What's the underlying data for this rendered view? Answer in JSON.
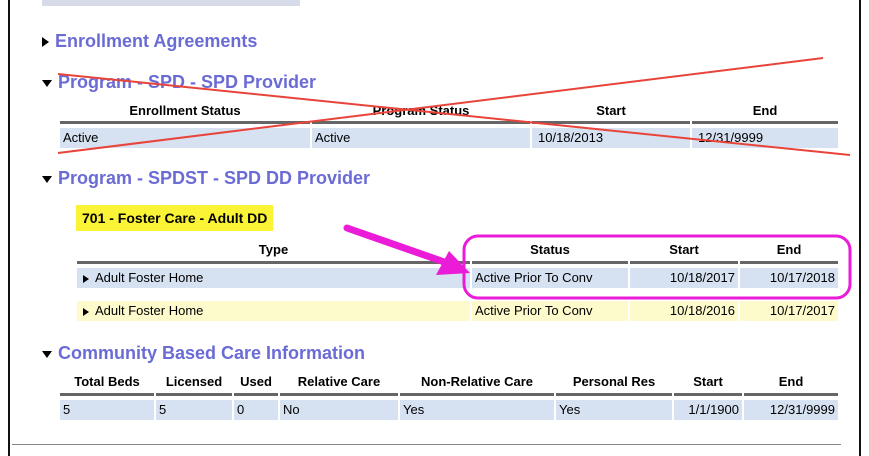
{
  "sections": {
    "enrollment": {
      "title": "Enrollment Agreements"
    },
    "program_spd": {
      "title": "Program - SPD - SPD Provider",
      "headers": [
        "Enrollment Status",
        "Program Status",
        "Start",
        "End"
      ],
      "row": [
        "Active",
        "Active",
        "10/18/2013",
        "12/31/9999"
      ]
    },
    "program_spdst": {
      "title": "Program - SPDST - SPD DD Provider",
      "badge": "701 - Foster Care - Adult DD",
      "headers": [
        "Type",
        "Status",
        "Start",
        "End"
      ],
      "rows": [
        [
          "Adult Foster Home",
          "Active Prior To Conv",
          "10/18/2017",
          "10/17/2018"
        ],
        [
          "Adult Foster Home",
          "Active Prior To Conv",
          "10/18/2016",
          "10/17/2017"
        ]
      ]
    },
    "community": {
      "title": "Community Based Care Information",
      "headers": [
        "Total Beds",
        "Licensed",
        "Used",
        "Relative Care",
        "Non-Relative Care",
        "Personal Res",
        "Start",
        "End"
      ],
      "row": [
        "5",
        "5",
        "0",
        "No",
        "Yes",
        "Yes",
        "1/1/1900",
        "12/31/9999"
      ]
    }
  },
  "annotations": {
    "strike_color": "#e8443a",
    "highlight_color": "#ea1cd8",
    "badge_color": "#fbf335"
  }
}
